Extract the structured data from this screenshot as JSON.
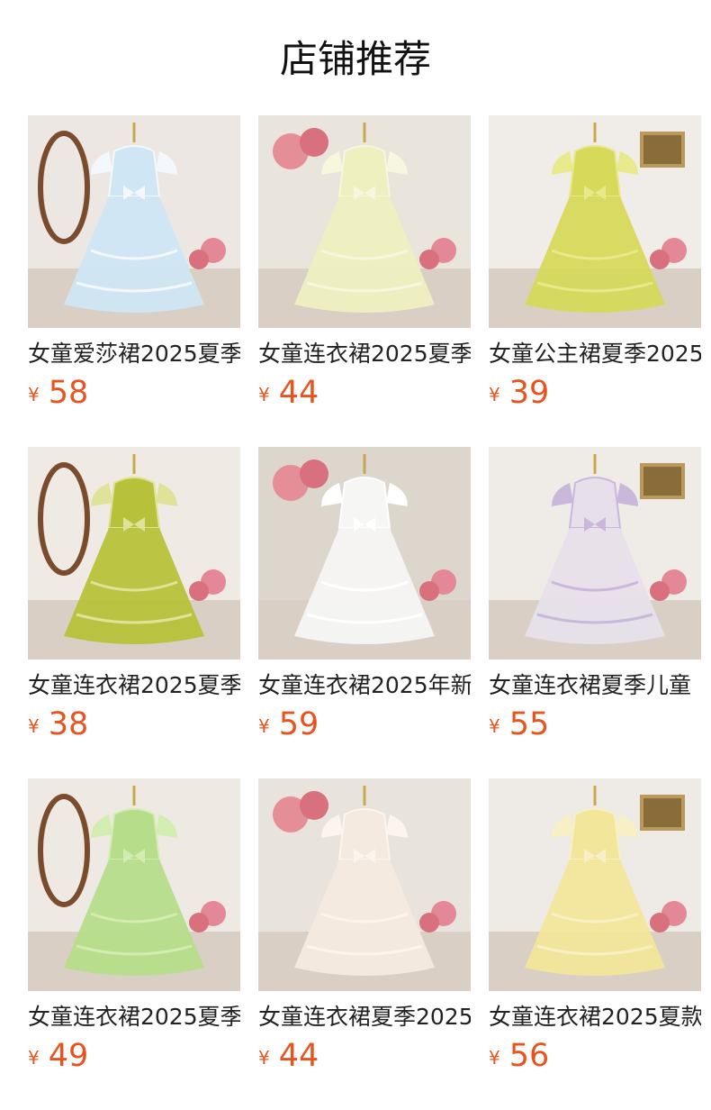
{
  "section": {
    "title": "店铺推荐"
  },
  "currency_symbol": "¥",
  "price_color": "#e8541e",
  "products": [
    {
      "title": "女童爱莎裙2025夏季",
      "price": "58",
      "image": "light-blue-princess-dress-photo",
      "dress_color": "#cfe6f4",
      "accent_color": "#f3f8fc",
      "bg_color": "#ece7e2"
    },
    {
      "title": "女童连衣裙2025夏季",
      "price": "44",
      "image": "pale-yellow-tulle-dress-photo",
      "dress_color": "#eef0c0",
      "accent_color": "#f7f6df",
      "bg_color": "#e9e4dc"
    },
    {
      "title": "女童公主裙夏季2025",
      "price": "39",
      "image": "lime-green-bow-dress-photo",
      "dress_color": "#d6d95a",
      "accent_color": "#e8e98a",
      "bg_color": "#f0ece7"
    },
    {
      "title": "女童连衣裙2025夏季",
      "price": "38",
      "image": "olive-green-sleeveless-dress-photo",
      "dress_color": "#b7c23a",
      "accent_color": "#dfe39a",
      "bg_color": "#efeae4"
    },
    {
      "title": "女童连衣裙2025年新",
      "price": "59",
      "image": "white-butterfly-tulle-dress-photo",
      "dress_color": "#f6f6f4",
      "accent_color": "#ffffff",
      "bg_color": "#ddd6cc"
    },
    {
      "title": "女童连衣裙夏季儿童",
      "price": "55",
      "image": "lavender-big-bow-dress-photo",
      "dress_color": "#e7e0ea",
      "accent_color": "#c9b8dc",
      "bg_color": "#efebe6"
    },
    {
      "title": "女童连衣裙2025夏季",
      "price": "49",
      "image": "mint-green-tiered-dress-photo",
      "dress_color": "#b6dd8a",
      "accent_color": "#d3ecb0",
      "bg_color": "#eeeae3"
    },
    {
      "title": "女童连衣裙夏季2025",
      "price": "44",
      "image": "cream-chiffon-dress-photo",
      "dress_color": "#f4eadf",
      "accent_color": "#fbf5ee",
      "bg_color": "#e8e3dc"
    },
    {
      "title": "女童连衣裙2025夏款",
      "price": "56",
      "image": "yellow-bubble-dress-photo",
      "dress_color": "#f2e69a",
      "accent_color": "#f8f0c4",
      "bg_color": "#eeeae5"
    }
  ]
}
